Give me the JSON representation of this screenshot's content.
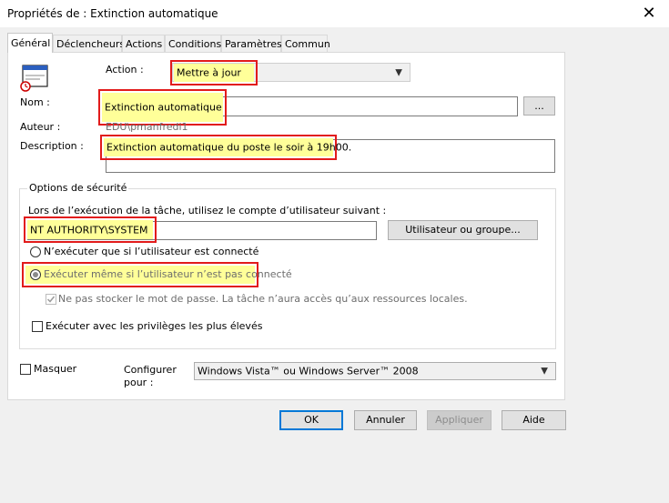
{
  "window": {
    "title": "Propriétés de : Extinction automatique"
  },
  "tabs": [
    {
      "label": "Général"
    },
    {
      "label": "Déclencheurs"
    },
    {
      "label": "Actions"
    },
    {
      "label": "Conditions"
    },
    {
      "label": "Paramètres"
    },
    {
      "label": "Commun"
    }
  ],
  "general": {
    "action_label": "Action :",
    "action_value": "Mettre à jour",
    "name_label": "Nom :",
    "name_value": "Extinction automatique",
    "browse_label": "...",
    "author_label": "Auteur :",
    "author_value": "EDU\\pmanfredi1",
    "description_label": "Description :",
    "description_value": "Extinction automatique du poste le soir à 19h00."
  },
  "security": {
    "legend": "Options de sécurité",
    "account_prompt": "Lors de l’exécution de la tâche, utilisez le compte d’utilisateur suivant :",
    "account_value": "NT AUTHORITY\\SYSTEM",
    "user_group_button": "Utilisateur ou groupe...",
    "radio_logged_on": "N’exécuter que si l’utilisateur est connecté",
    "radio_whether": "Exécuter même si l’utilisateur n’est pas connecté",
    "no_store_password": "Ne pas stocker le mot de passe. La tâche n’aura accès qu’aux ressources locales.",
    "highest_privileges": "Exécuter avec les privilèges les plus élevés"
  },
  "bottom": {
    "hidden_label": "Masquer",
    "configure_label": "Configurer pour :",
    "configure_value": "Windows Vista™ ou Windows Server™ 2008"
  },
  "buttons": {
    "ok": "OK",
    "cancel": "Annuler",
    "apply": "Appliquer",
    "help": "Aide"
  },
  "colors": {
    "highlight": "#ffff99",
    "annotation_border": "#e21b1b",
    "default_button_border": "#0078d7"
  }
}
